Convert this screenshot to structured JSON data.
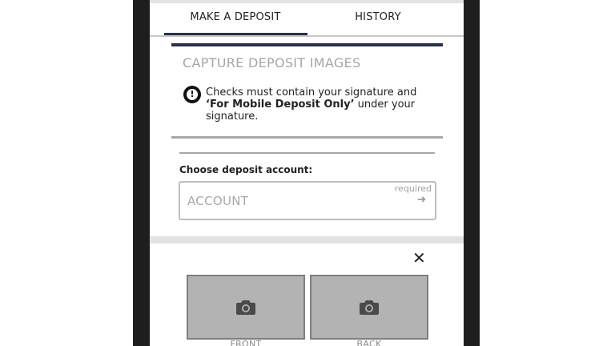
{
  "tabs": [
    {
      "label": "MAKE A DEPOSIT",
      "active": true
    },
    {
      "label": "HISTORY",
      "active": false
    }
  ],
  "capture": {
    "title": "CAPTURE DEPOSIT IMAGES",
    "notice_line1": "Checks must contain your signature and",
    "notice_bold": "‘For Mobile Deposit Only’",
    "notice_rest": " under your signature."
  },
  "account": {
    "label": "Choose deposit account:",
    "placeholder": "ACCOUNT",
    "required": "required"
  },
  "images": {
    "front_label": "FRONT",
    "back_label": "BACK"
  },
  "colors": {
    "accent": "#2a3148",
    "bezel": "#1e1e1e",
    "photo_fill": "#b3b3b3"
  },
  "icons": [
    "alert-icon",
    "arrow-right-icon",
    "close-icon",
    "camera-icon"
  ]
}
